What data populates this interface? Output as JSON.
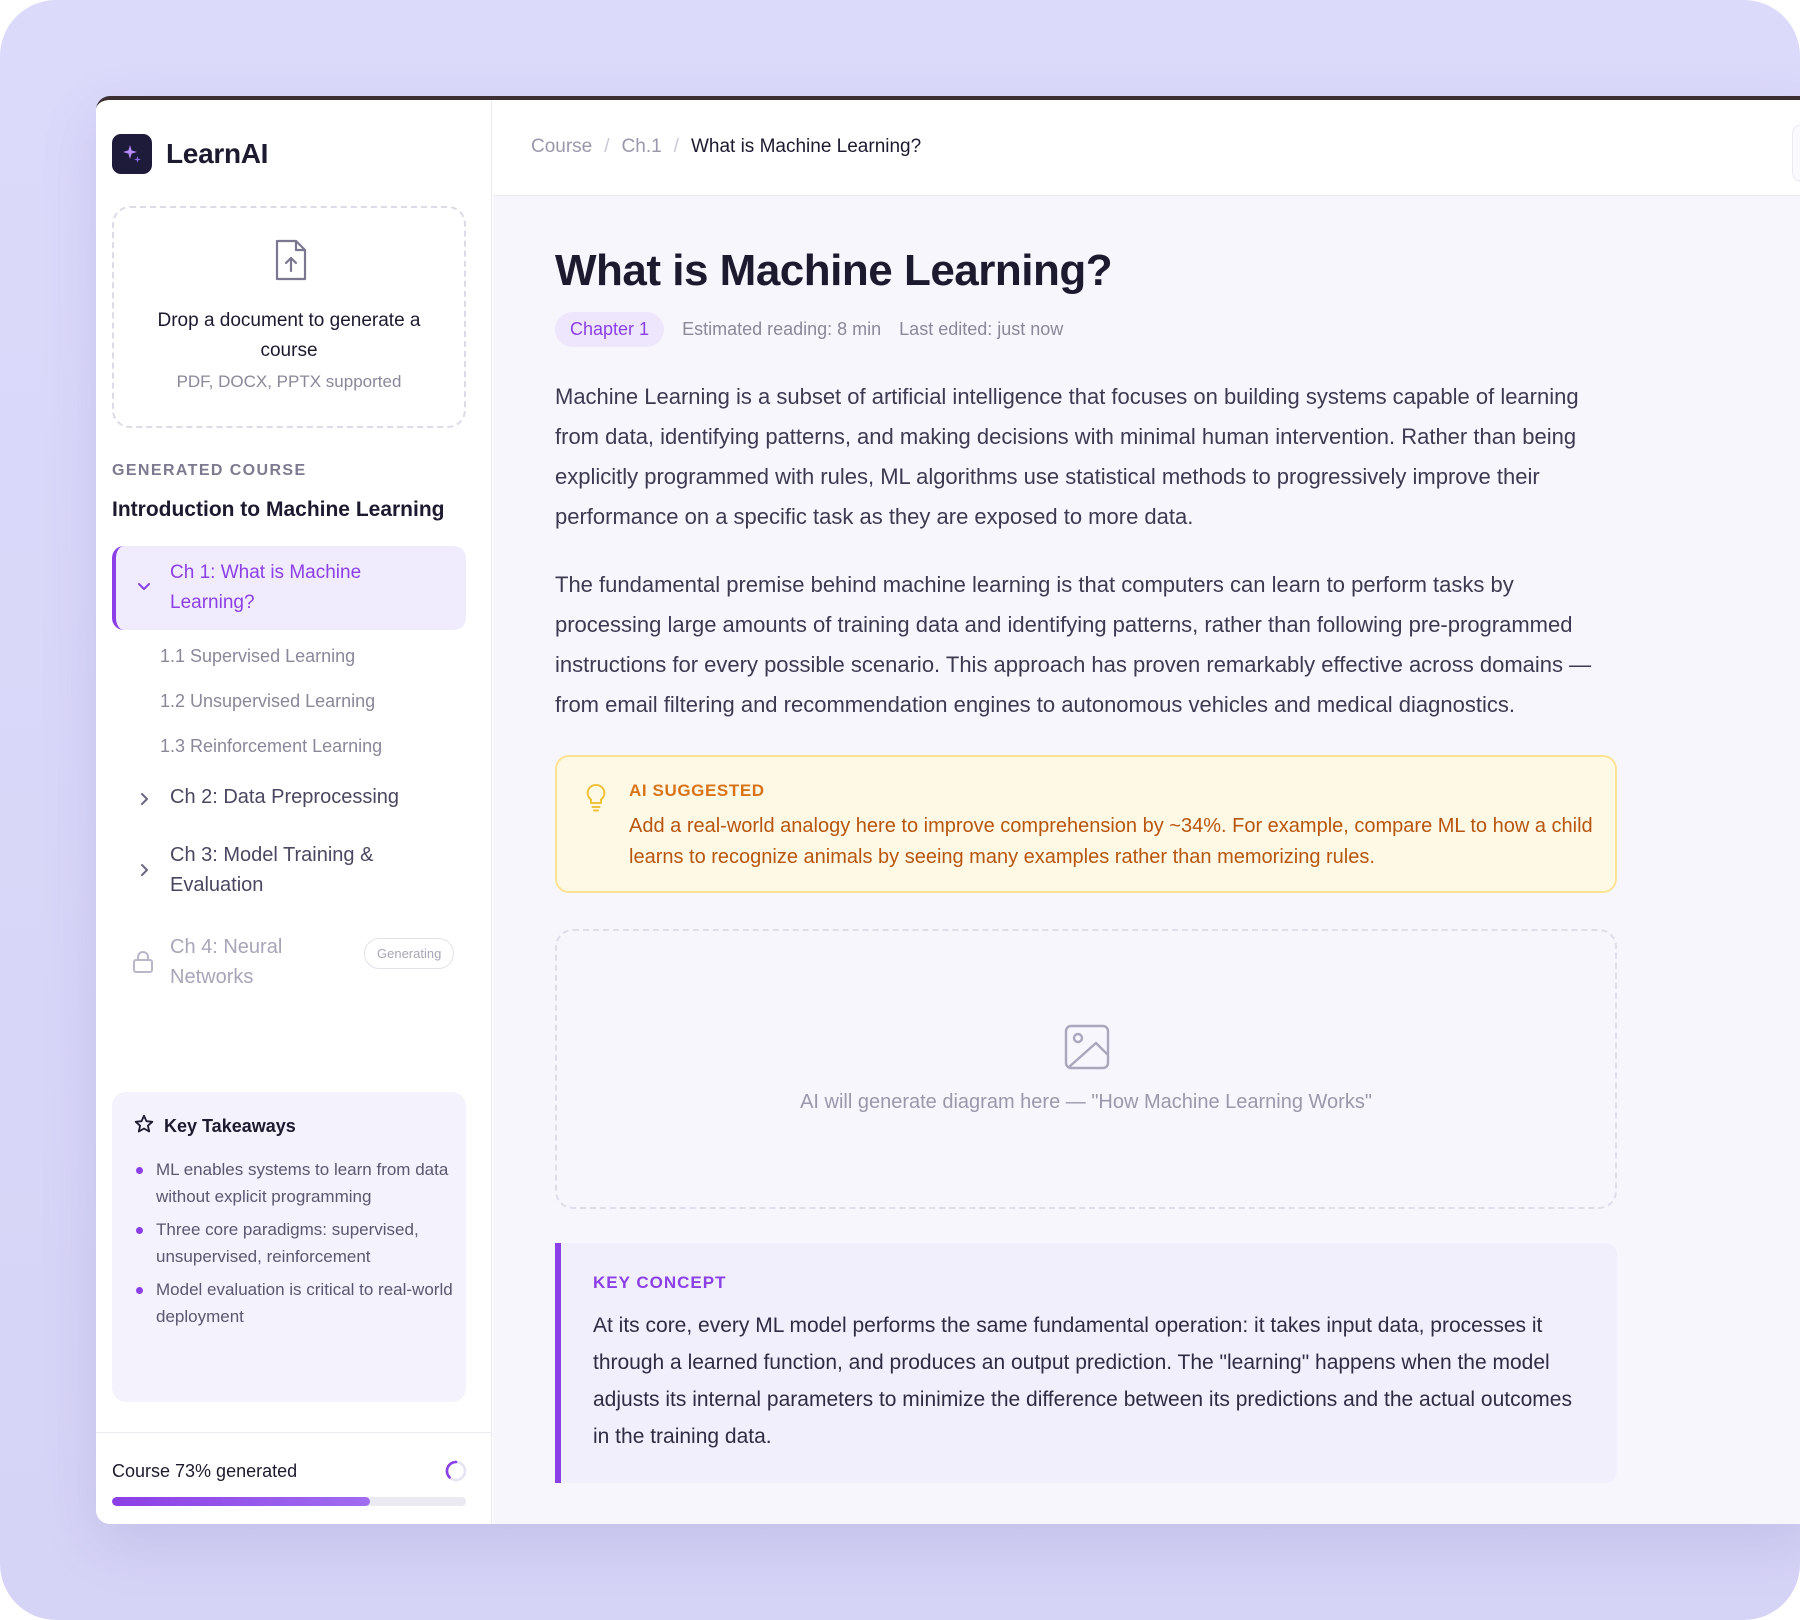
{
  "brand": {
    "name": "LearnAI",
    "logo_icon": "sparkle-icon"
  },
  "upload": {
    "title": "Drop a document to generate a course",
    "subtitle": "PDF, DOCX, PPTX supported",
    "icon": "file-upload-icon"
  },
  "sidebar": {
    "section_label": "GENERATED COURSE",
    "course_title": "Introduction to Machine Learning",
    "chapters": [
      {
        "label": "Ch 1: What is Machine Learning?",
        "state": "active"
      },
      {
        "label": "Ch 2: Data Preprocessing",
        "state": "collapsed"
      },
      {
        "label": "Ch 3: Model Training & Evaluation",
        "state": "collapsed"
      },
      {
        "label": "Ch 4: Neural Networks",
        "state": "locked",
        "badge": "Generating"
      }
    ],
    "subitems": [
      "1.1 Supervised Learning",
      "1.2 Unsupervised Learning",
      "1.3 Reinforcement Learning"
    ],
    "takeaways": {
      "title": "Key Takeaways",
      "items": [
        "ML enables systems to learn from data without explicit programming",
        "Three core paradigms: supervised, unsupervised, reinforcement",
        "Model evaluation is critical to real-world deployment"
      ]
    },
    "progress": {
      "label": "Course 73% generated",
      "value": 0.73
    }
  },
  "breadcrumb": {
    "items": [
      "Course",
      "Ch.1"
    ],
    "separator": "/",
    "current": "What is Machine Learning?"
  },
  "article": {
    "title": "What is Machine Learning?",
    "chip": "Chapter 1",
    "reading": "Estimated reading: 8 min",
    "edited": "Last edited: just now",
    "paragraphs": [
      "Machine Learning is a subset of artificial intelligence that focuses on building systems capable of learning from data, identifying patterns, and making decisions with minimal human intervention. Rather than being explicitly programmed with rules, ML algorithms use statistical methods to progressively improve their performance on a specific task as they are exposed to more data.",
      "The fundamental premise behind machine learning is that computers can learn to perform tasks by processing large amounts of training data and identifying patterns, rather than following pre-programmed instructions for every possible scenario. This approach has proven remarkably effective across domains — from email filtering and recommendation engines to autonomous vehicles and medical diagnostics."
    ],
    "ai_suggestion": {
      "label": "AI SUGGESTED",
      "text": "Add a real-world analogy here to improve comprehension by ~34%. For example, compare ML to how a child learns to recognize animals by seeing many examples rather than memorizing rules."
    },
    "diagram_placeholder": "AI will generate diagram here — \"How Machine Learning Works\"",
    "key_concept": {
      "label": "KEY CONCEPT",
      "text": "At its core, every ML model performs the same fundamental operation: it takes input data, processes it through a learned function, and produces an output prediction. The \"learning\" happens when the model adjusts its internal parameters to minimize the difference between its predictions and the actual outcomes in the training data."
    }
  },
  "colors": {
    "accent": "#8b3fe6",
    "background": "#dcdafb",
    "suggestion_bg": "#fef9e5",
    "suggestion_text": "#b8550f"
  }
}
